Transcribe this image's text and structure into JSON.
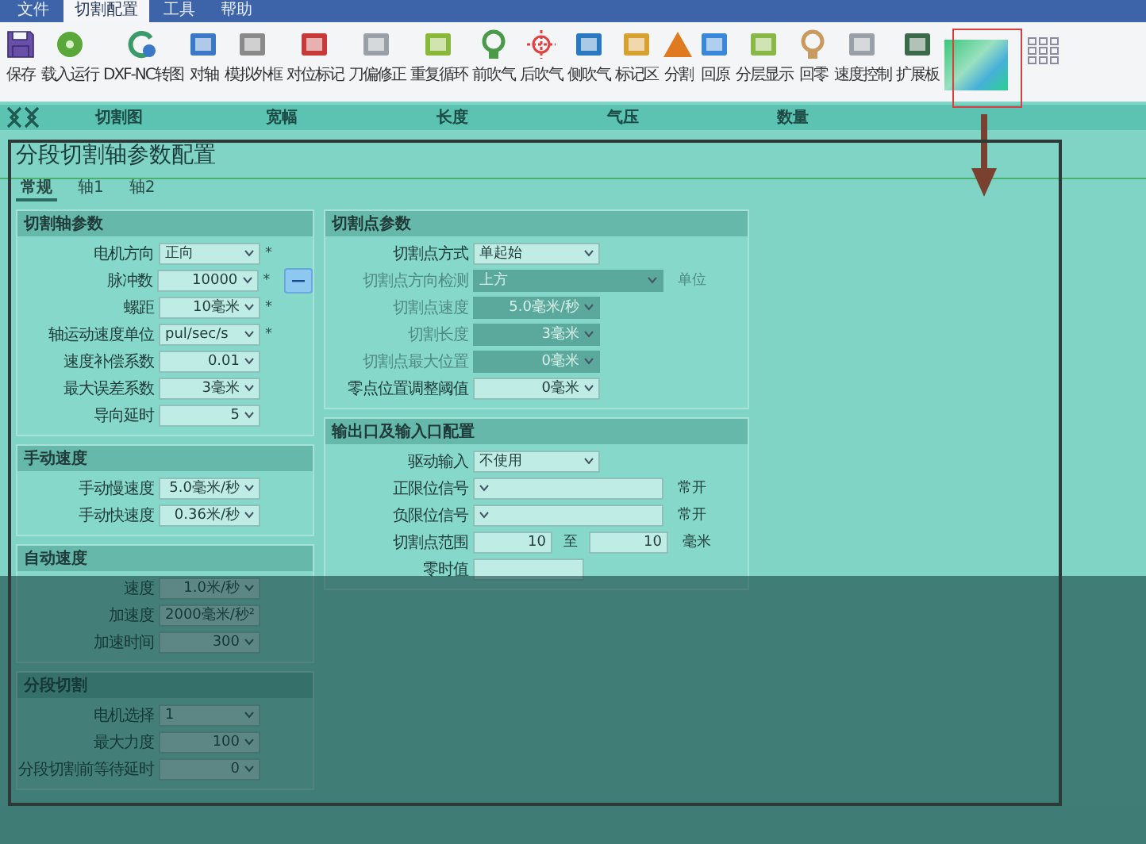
{
  "menu": [
    {
      "label": "文件",
      "selected": false
    },
    {
      "label": "切割配置",
      "selected": true
    },
    {
      "label": "工具",
      "selected": false
    },
    {
      "label": "帮助",
      "selected": false
    }
  ],
  "toolbar": [
    {
      "label": "保存",
      "kind": "save"
    },
    {
      "label": "载入运行",
      "kind": "disc"
    },
    {
      "label": "DXF-NC转图",
      "kind": "refresh"
    },
    {
      "label": "对轴",
      "kind": "target"
    },
    {
      "label": "模拟外框",
      "kind": "frame"
    },
    {
      "label": "对位标记",
      "kind": "pin"
    },
    {
      "label": "刀偏修正",
      "kind": "page"
    },
    {
      "label": "重复循环",
      "kind": "screen"
    },
    {
      "label": "前吹气",
      "kind": "bulb"
    },
    {
      "label": "后吹气",
      "kind": "cross"
    },
    {
      "label": "侧吹气",
      "kind": "blow"
    },
    {
      "label": "标记区",
      "kind": "box"
    },
    {
      "label": "分割",
      "kind": "warn"
    },
    {
      "label": "回原",
      "kind": "download"
    },
    {
      "label": "分层显示",
      "kind": "layers"
    },
    {
      "label": "回零",
      "kind": "lamp"
    },
    {
      "label": "速度控制",
      "kind": "page"
    },
    {
      "label": "扩展板",
      "kind": "board"
    }
  ],
  "columns": [
    "切割图",
    "宽幅",
    "长度",
    "气压",
    "数量"
  ],
  "title": "分段切割轴参数配置",
  "tabs": [
    {
      "label": "常规",
      "selected": true
    },
    {
      "label": "轴1",
      "selected": false
    },
    {
      "label": "轴2",
      "selected": false
    }
  ],
  "left_groups": [
    {
      "title": "切割轴参数",
      "fields": [
        {
          "label": "电机方向",
          "value": "正向",
          "kind": "select",
          "mark": "*"
        },
        {
          "label": "脉冲数",
          "value": "10000",
          "kind": "spin",
          "mark": "*",
          "side_button": true
        },
        {
          "label": "螺距",
          "value": "10毫米",
          "kind": "spin",
          "mark": "*"
        },
        {
          "label": "轴运动速度单位",
          "value": "pul/sec/s",
          "kind": "select",
          "mark": "*"
        },
        {
          "label": "速度补偿系数",
          "value": "0.01",
          "kind": "spin"
        },
        {
          "label": "最大误差系数",
          "value": "3毫米",
          "kind": "spin"
        },
        {
          "label": "导向延时",
          "value": "5",
          "kind": "spin"
        }
      ]
    },
    {
      "title": "手动速度",
      "fields": [
        {
          "label": "手动慢速度",
          "value": "5.0毫米/秒",
          "kind": "spin"
        },
        {
          "label": "手动快速度",
          "value": "0.36米/秒",
          "kind": "spin"
        }
      ]
    },
    {
      "title": "自动速度",
      "fields": [
        {
          "label": "速度",
          "value": "1.0米/秒",
          "kind": "spin"
        },
        {
          "label": "加速度",
          "value": "2000毫米/秒²",
          "kind": "spin"
        },
        {
          "label": "加速时间",
          "value": "300",
          "kind": "spin"
        }
      ]
    },
    {
      "title": "分段切割",
      "fields": [
        {
          "label": "电机选择",
          "value": "1",
          "kind": "select"
        },
        {
          "label": "最大力度",
          "value": "100",
          "kind": "spin"
        },
        {
          "label": "分段切割前等待延时",
          "value": "0",
          "kind": "spin"
        }
      ]
    }
  ],
  "right_groups": [
    {
      "title": "切割点参数",
      "fields": [
        {
          "label": "切割点方式",
          "value": "单起始",
          "kind": "select",
          "disabled": false
        },
        {
          "label": "切割点方向检测",
          "value": "上方",
          "kind": "select",
          "unit": "单位",
          "disabled": true
        },
        {
          "label": "切割点速度",
          "value": "5.0毫米/秒",
          "kind": "spin",
          "disabled": true
        },
        {
          "label": "切割长度",
          "value": "3毫米",
          "kind": "spin",
          "disabled": true
        },
        {
          "label": "切割点最大位置",
          "value": "0毫米",
          "kind": "spin",
          "disabled": true
        },
        {
          "label": "零点位置调整阈值",
          "value": "0毫米",
          "kind": "spin",
          "disabled": false
        }
      ]
    },
    {
      "title": "输出口及输入口配置",
      "fields": [
        {
          "label": "驱动输入",
          "value": "不使用",
          "kind": "select",
          "disabled": false
        },
        {
          "label": "正限位信号",
          "kind": "select",
          "unit": "常开",
          "disabled": false
        },
        {
          "label": "负限位信号",
          "kind": "select",
          "unit": "常开",
          "disabled": false
        },
        {
          "label": "切割点范围",
          "value": "10",
          "kind": "range",
          "between": "至",
          "value2": "10",
          "unit": "毫米",
          "disabled": false
        },
        {
          "label": "零时值",
          "kind": "text",
          "disabled": false
        }
      ]
    }
  ]
}
